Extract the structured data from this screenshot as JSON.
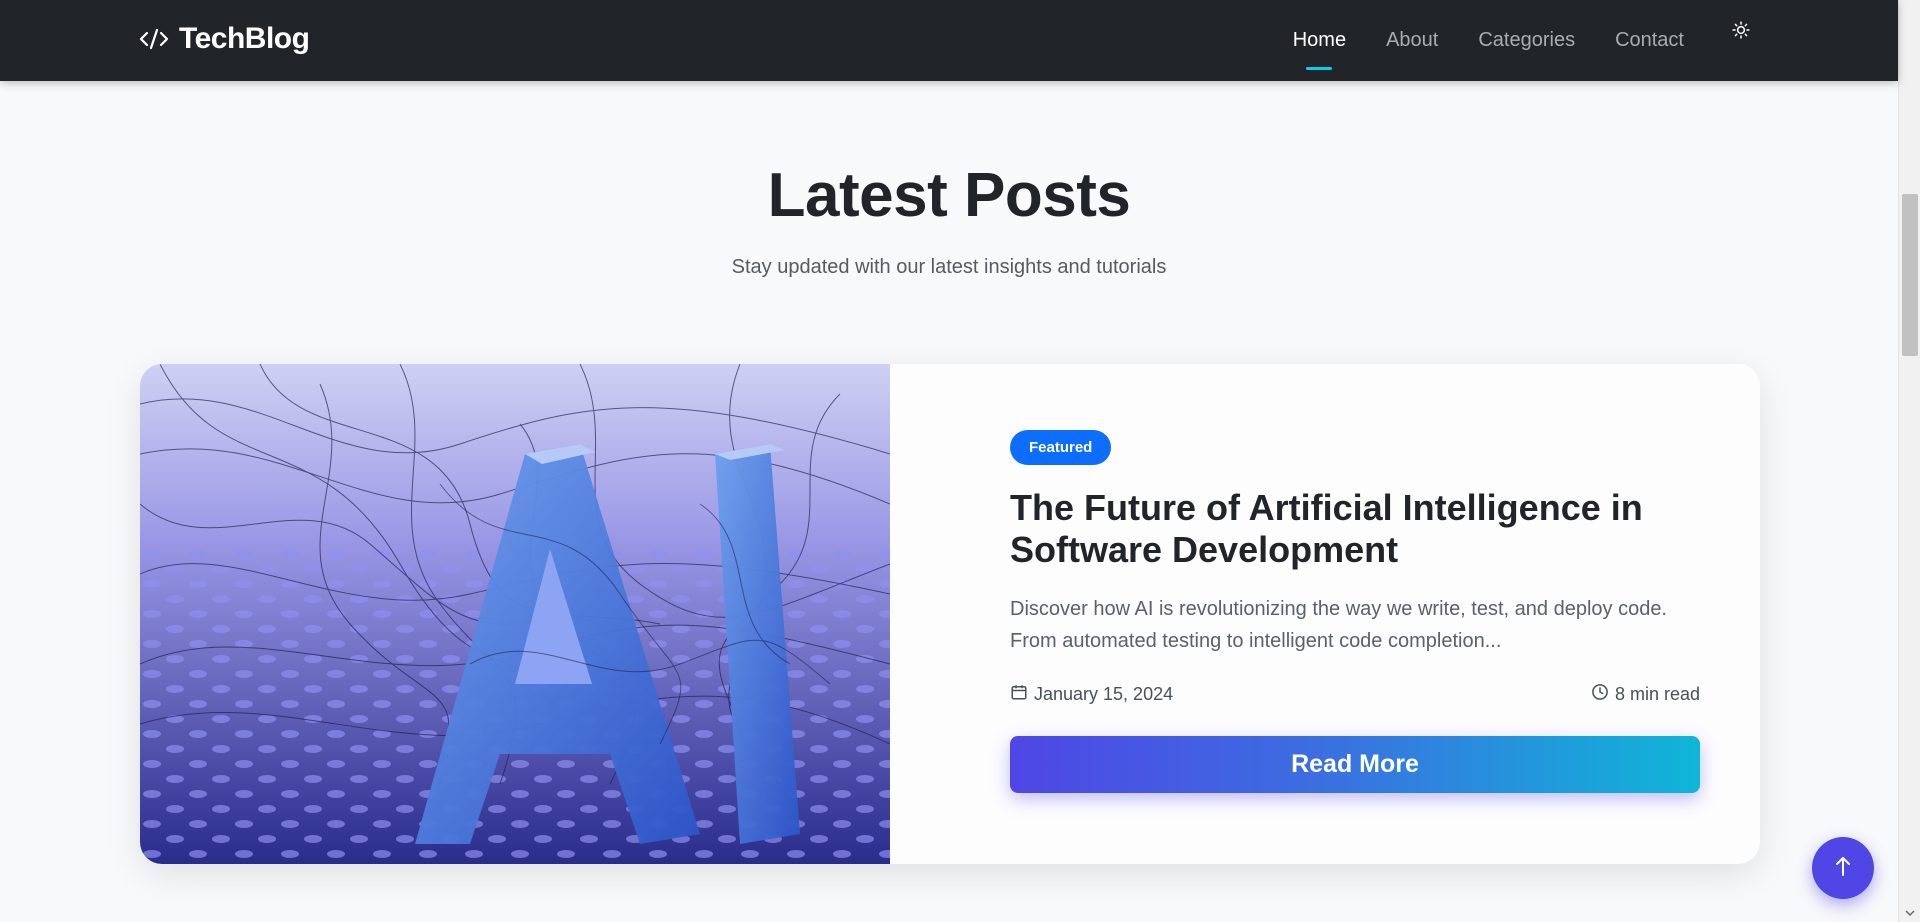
{
  "nav": {
    "brand": "TechBlog",
    "links": [
      {
        "label": "Home",
        "active": true
      },
      {
        "label": "About",
        "active": false
      },
      {
        "label": "Categories",
        "active": false
      },
      {
        "label": "Contact",
        "active": false
      }
    ],
    "theme_icon": "sun-icon"
  },
  "hero": {
    "title": "Latest Posts",
    "subtitle": "Stay updated with our latest insights and tutorials"
  },
  "featured_post": {
    "badge": "Featured",
    "title": "The Future of Artificial Intelligence in Software Development",
    "excerpt": "Discover how AI is revolutionizing the way we write, test, and deploy code. From automated testing to intelligent code completion...",
    "date": "January 15, 2024",
    "read_time": "8 min read",
    "button_label": "Read More",
    "image_text": "AI"
  },
  "colors": {
    "navbar": "#212529",
    "accent": "#0d6efd",
    "gradient_start": "#4f46e5",
    "gradient_end": "#0fb6d8",
    "active_underline": "#0dcaf0"
  }
}
